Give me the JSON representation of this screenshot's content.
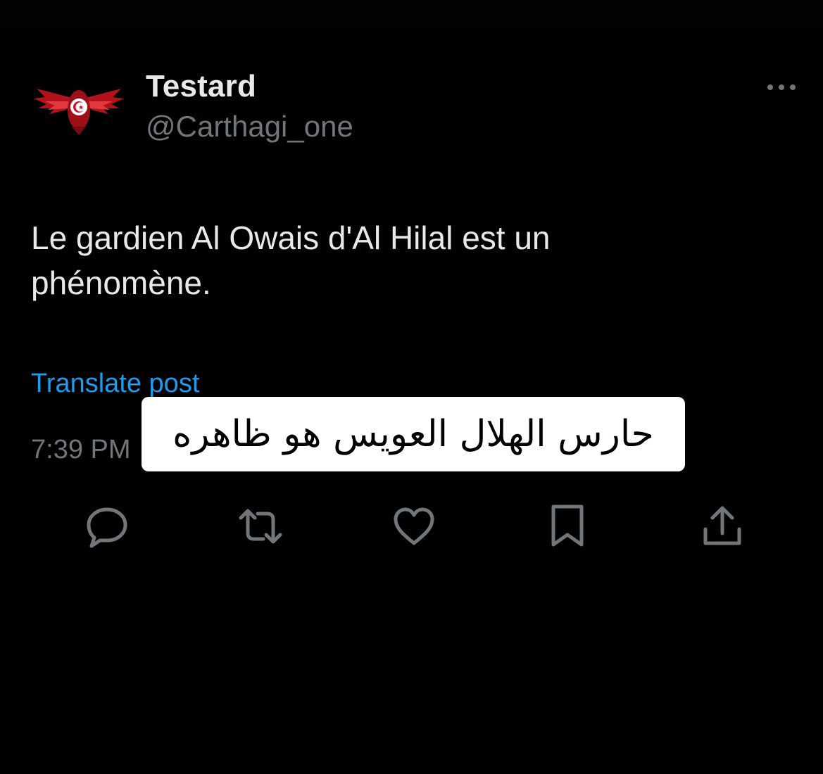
{
  "tweet": {
    "author": {
      "display_name": "Testard",
      "handle": "@Carthagi_one",
      "avatar_icon": "winged-tunisia-flag-icon"
    },
    "text": "Le gardien Al Owais d'Al Hilal est un phénomène.",
    "translate_label": "Translate post",
    "time": "7:39 PM",
    "more_icon": "more-dots-icon"
  },
  "overlay": {
    "caption": "حارس الهلال العويس هو ظاهره"
  },
  "actions": [
    {
      "name": "reply",
      "icon": "reply-bubble-icon"
    },
    {
      "name": "repost",
      "icon": "repost-arrows-icon"
    },
    {
      "name": "like",
      "icon": "heart-icon"
    },
    {
      "name": "bookmark",
      "icon": "bookmark-icon"
    },
    {
      "name": "share",
      "icon": "share-upload-icon"
    }
  ],
  "colors": {
    "background": "#000000",
    "primary_text": "#e7e9ea",
    "secondary_text": "#71767b",
    "link": "#1d9bf0",
    "overlay_bg": "#ffffff"
  }
}
